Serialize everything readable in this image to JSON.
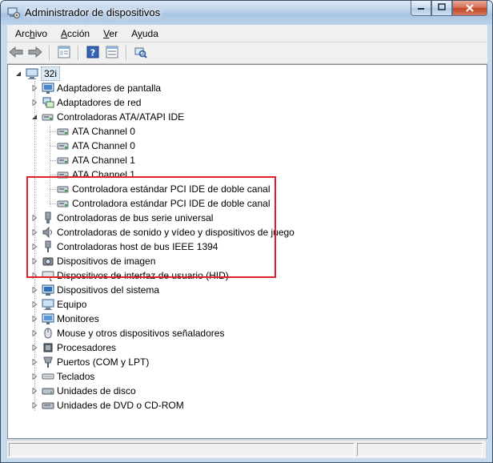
{
  "window": {
    "title": "Administrador de dispositivos",
    "minimize_icon": "minimize-icon",
    "maximize_icon": "maximize-icon",
    "close_icon": "close-icon"
  },
  "menu": [
    {
      "label": "Archivo",
      "access": "h"
    },
    {
      "label": "Acción",
      "access": "A"
    },
    {
      "label": "Ver",
      "access": "V"
    },
    {
      "label": "Ayuda",
      "access": "y"
    }
  ],
  "toolbar": {
    "buttons": [
      "back-arrow-icon",
      "forward-arrow-icon",
      "properties-icon",
      "help-icon",
      "show-hidden-icon",
      "scan-hardware-icon"
    ]
  },
  "tree": {
    "root": {
      "label": "32i",
      "icon": "computer-icon"
    },
    "categories": [
      {
        "label": "Adaptadores de pantalla",
        "icon": "display-adapter-icon",
        "expanded": false
      },
      {
        "label": "Adaptadores de red",
        "icon": "network-adapter-icon",
        "expanded": false
      },
      {
        "label": "Controladoras ATA/ATAPI IDE",
        "icon": "ide-controller-icon",
        "expanded": true,
        "children": [
          {
            "label": "ATA Channel 0",
            "icon": "ide-channel-icon"
          },
          {
            "label": "ATA Channel 0",
            "icon": "ide-channel-icon"
          },
          {
            "label": "ATA Channel 1",
            "icon": "ide-channel-icon"
          },
          {
            "label": "ATA Channel 1",
            "icon": "ide-channel-icon"
          },
          {
            "label": "Controladora estándar PCI IDE de doble canal",
            "icon": "ide-channel-icon"
          },
          {
            "label": "Controladora estándar PCI IDE de doble canal",
            "icon": "ide-channel-icon"
          }
        ]
      },
      {
        "label": "Controladoras de bus serie universal",
        "icon": "usb-icon",
        "expanded": false
      },
      {
        "label": "Controladoras de sonido y vídeo y dispositivos de juego",
        "icon": "sound-icon",
        "expanded": false
      },
      {
        "label": "Controladoras host de bus IEEE 1394",
        "icon": "firewire-icon",
        "expanded": false
      },
      {
        "label": "Dispositivos de imagen",
        "icon": "imaging-icon",
        "expanded": false
      },
      {
        "label": "Dispositivos de interfaz de usuario (HID)",
        "icon": "hid-icon",
        "expanded": false
      },
      {
        "label": "Dispositivos del sistema",
        "icon": "system-devices-icon",
        "expanded": false
      },
      {
        "label": "Equipo",
        "icon": "computer-icon",
        "expanded": false
      },
      {
        "label": "Monitores",
        "icon": "monitor-icon",
        "expanded": false
      },
      {
        "label": "Mouse y otros dispositivos señaladores",
        "icon": "mouse-icon",
        "expanded": false
      },
      {
        "label": "Procesadores",
        "icon": "processor-icon",
        "expanded": false
      },
      {
        "label": "Puertos (COM y LPT)",
        "icon": "port-icon",
        "expanded": false
      },
      {
        "label": "Teclados",
        "icon": "keyboard-icon",
        "expanded": false
      },
      {
        "label": "Unidades de disco",
        "icon": "disk-drive-icon",
        "expanded": false
      },
      {
        "label": "Unidades de DVD o CD-ROM",
        "icon": "dvd-drive-icon",
        "expanded": false
      }
    ]
  },
  "colors": {
    "highlight_border": "#e0202a",
    "root_selection": "#dde9f5"
  }
}
